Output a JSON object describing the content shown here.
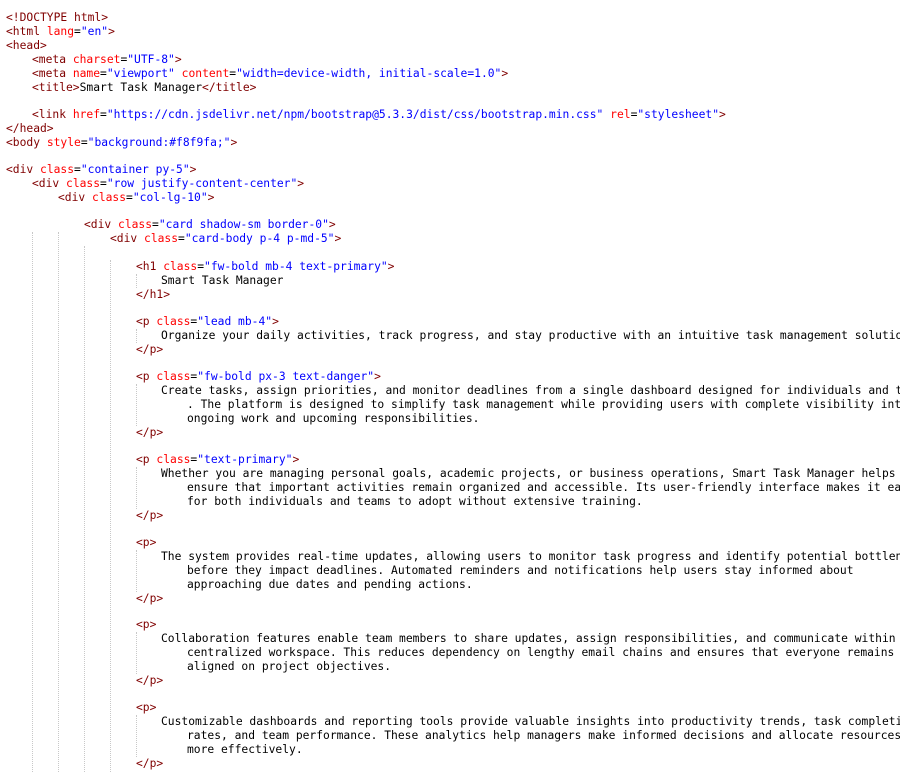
{
  "code": {
    "l1": {
      "a": "<!DOCTYPE html>"
    },
    "l2": {
      "o": "<html",
      "a1": " lang",
      "eq": "=",
      "v1": "\"en\"",
      "c": ">"
    },
    "l3": {
      "a": "<head>"
    },
    "l4": {
      "o": "<meta",
      "a1": " charset",
      "eq": "=",
      "v1": "\"UTF-8\"",
      "c": ">"
    },
    "l5": {
      "o": "<meta",
      "a1": " name",
      "eq1": "=",
      "v1": "\"viewport\"",
      "a2": " content",
      "eq2": "=",
      "v2": "\"width=device-width, initial-scale=1.0\"",
      "c": ">"
    },
    "l6": {
      "o": "<title>",
      "t": "Smart Task Manager",
      "c": "</title>"
    },
    "l8": {
      "o": "<link",
      "a1": " href",
      "eq1": "=",
      "v1": "\"https://cdn.jsdelivr.net/npm/bootstrap@5.3.3/dist/css/bootstrap.min.css\"",
      "a2": " rel",
      "eq2": "=",
      "v2": "\"stylesheet\"",
      "c": ">"
    },
    "l9": {
      "a": "</head>"
    },
    "l10": {
      "o": "<body",
      "a1": " style",
      "eq": "=",
      "v1": "\"background:#f8f9fa;\"",
      "c": ">"
    },
    "l12": {
      "o": "<div",
      "a1": " class",
      "eq": "=",
      "v1": "\"container py-5\"",
      "c": ">"
    },
    "l13": {
      "o": "<div",
      "a1": " class",
      "eq": "=",
      "v1": "\"row justify-content-center\"",
      "c": ">"
    },
    "l14": {
      "o": "<div",
      "a1": " class",
      "eq": "=",
      "v1": "\"col-lg-10\"",
      "c": ">"
    },
    "l16": {
      "o": "<div",
      "a1": " class",
      "eq": "=",
      "v1": "\"card shadow-sm border-0\"",
      "c": ">"
    },
    "l17": {
      "o": "<div",
      "a1": " class",
      "eq": "=",
      "v1": "\"card-body p-4 p-md-5\"",
      "c": ">"
    },
    "l19": {
      "o": "<h1",
      "a1": " class",
      "eq": "=",
      "v1": "\"fw-bold mb-4 text-primary\"",
      "c": ">"
    },
    "l20": {
      "t": "Smart Task Manager"
    },
    "l21": {
      "a": "</h1>"
    },
    "l23": {
      "o": "<p",
      "a1": " class",
      "eq": "=",
      "v1": "\"lead mb-4\"",
      "c": ">"
    },
    "l24": {
      "t": "Organize your daily activities, track progress, and stay productive with an intuitive task management solution."
    },
    "l25": {
      "a": "</p>"
    },
    "l27": {
      "o": "<p",
      "a1": " class",
      "eq": "=",
      "v1": "\"fw-bold px-3 text-danger\"",
      "c": ">"
    },
    "l28": {
      "t": "Create tasks, assign priorities, and monitor deadlines from a single dashboard designed for individuals and teams"
    },
    "l28b": {
      "t": ". The platform is designed to simplify task management while providing users with complete visibility into"
    },
    "l28c": {
      "t": "ongoing work and upcoming responsibilities."
    },
    "l29": {
      "a": "</p>"
    },
    "l31": {
      "o": "<p",
      "a1": " class",
      "eq": "=",
      "v1": "\"text-primary\"",
      "c": ">"
    },
    "l32": {
      "t": "Whether you are managing personal goals, academic projects, or business operations, Smart Task Manager helps"
    },
    "l32b": {
      "t": "ensure that important activities remain organized and accessible. Its user-friendly interface makes it easy"
    },
    "l32c": {
      "t": "for both individuals and teams to adopt without extensive training."
    },
    "l33": {
      "a": "</p>"
    },
    "l35": {
      "a": "<p>"
    },
    "l36": {
      "t": "The system provides real-time updates, allowing users to monitor task progress and identify potential bottlenecks"
    },
    "l36b": {
      "t": "before they impact deadlines. Automated reminders and notifications help users stay informed about"
    },
    "l36c": {
      "t": "approaching due dates and pending actions."
    },
    "l37": {
      "a": "</p>"
    },
    "l39": {
      "a": "<p>"
    },
    "l40": {
      "t": "Collaboration features enable team members to share updates, assign responsibilities, and communicate within a"
    },
    "l40b": {
      "t": "centralized workspace. This reduces dependency on lengthy email chains and ensures that everyone remains"
    },
    "l40c": {
      "t": "aligned on project objectives."
    },
    "l41": {
      "a": "</p>"
    },
    "l43": {
      "a": "<p>"
    },
    "l44": {
      "t": "Customizable dashboards and reporting tools provide valuable insights into productivity trends, task completion"
    },
    "l44b": {
      "t": "rates, and team performance. These analytics help managers make informed decisions and allocate resources"
    },
    "l44c": {
      "t": "more effectively."
    },
    "l45": {
      "a": "</p>"
    }
  }
}
